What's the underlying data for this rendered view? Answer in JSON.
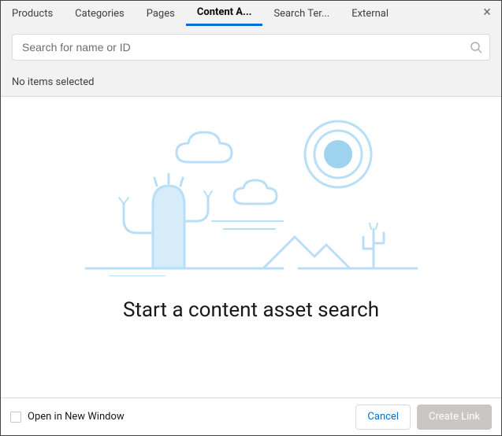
{
  "tabs": [
    {
      "label": "Products",
      "active": false
    },
    {
      "label": "Categories",
      "active": false
    },
    {
      "label": "Pages",
      "active": false
    },
    {
      "label": "Content A...",
      "active": true
    },
    {
      "label": "Search Ter...",
      "active": false
    },
    {
      "label": "External",
      "active": false
    }
  ],
  "close_glyph": "×",
  "search": {
    "placeholder": "Search for name or ID",
    "value": ""
  },
  "status_text": "No items selected",
  "empty_state": {
    "heading": "Start a content asset search"
  },
  "footer": {
    "checkbox_label": "Open in New Window",
    "checkbox_checked": false,
    "cancel_label": "Cancel",
    "create_label": "Create Link",
    "create_enabled": false
  },
  "colors": {
    "accent": "#0070d2",
    "illustration_stroke": "#b8dff7",
    "illustration_fill": "#d6ecf9"
  }
}
